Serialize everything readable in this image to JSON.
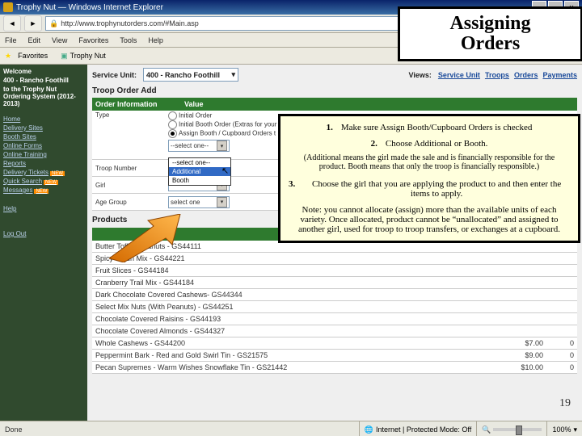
{
  "window": {
    "title": "Trophy Nut — Windows Internet Explorer"
  },
  "address": {
    "url": "http://www.trophynutorders.com/#Main.asp"
  },
  "menu": [
    "File",
    "Edit",
    "View",
    "Favorites",
    "Tools",
    "Help"
  ],
  "favorites": {
    "label": "Favorites",
    "item": "Trophy Nut"
  },
  "sidebar": {
    "welcome1": "Welcome",
    "welcome2": "400 - Rancho Foothill",
    "welcome3": "to the Trophy Nut Ordering System (2012-2013)",
    "links": [
      {
        "label": "Home"
      },
      {
        "label": "Delivery Sites"
      },
      {
        "label": "Booth Sites"
      },
      {
        "label": "Online Forms"
      },
      {
        "label": "Online Training"
      },
      {
        "label": "Reports"
      },
      {
        "label": "Delivery Tickets",
        "tag": "NEW"
      },
      {
        "label": "Quick Search",
        "tag": "NEW"
      },
      {
        "label": "Messages",
        "tag": "NEW"
      }
    ],
    "help": "Help",
    "logout": "Log Out"
  },
  "topctrls": {
    "su_label": "Service Unit:",
    "su_value": "400 - Rancho Foothill",
    "views_label": "Views:",
    "views": [
      "Service Unit",
      "Troops",
      "Orders",
      "Payments"
    ]
  },
  "section": {
    "title": "Troop Order Add"
  },
  "orderinfo": {
    "header_col1": "Order Information",
    "header_col2": "Value",
    "type_label": "Type",
    "radios": [
      "Initial Order",
      "Initial Booth Order (Extras for your",
      "Assign Booth / Cupboard Orders t"
    ],
    "sel_placeholder": "--select one--",
    "open_options": [
      "--select one--",
      "Additional",
      "Booth"
    ],
    "troop_label": "Troop Number",
    "girl_label": "Girl",
    "age_label": "Age Group",
    "age_value": "select one"
  },
  "products": {
    "title": "Products",
    "header": "Description",
    "rows": [
      {
        "desc": "Butter Toffee Peanuts - GS44111",
        "price": "",
        "qty": ""
      },
      {
        "desc": "Spicy Cajun Mix - GS44221",
        "price": "",
        "qty": ""
      },
      {
        "desc": "Fruit Slices - GS44184",
        "price": "",
        "qty": ""
      },
      {
        "desc": "Cranberry Trail Mix - GS44184",
        "price": "",
        "qty": ""
      },
      {
        "desc": "Dark Chocolate Covered Cashews- GS44344",
        "price": "",
        "qty": ""
      },
      {
        "desc": "Select Mix Nuts (With Peanuts) - GS44251",
        "price": "",
        "qty": ""
      },
      {
        "desc": "Chocolate Covered Raisins - GS44193",
        "price": "",
        "qty": ""
      },
      {
        "desc": "Chocolate Covered Almonds - GS44327",
        "price": "",
        "qty": ""
      },
      {
        "desc": "Whole Cashews - GS44200",
        "price": "$7.00",
        "qty": "0"
      },
      {
        "desc": "Peppermint Bark - Red and Gold Swirl Tin - GS21575",
        "price": "$9.00",
        "qty": "0"
      },
      {
        "desc": "Pecan Supremes - Warm Wishes Snowflake Tin - GS21442",
        "price": "$10.00",
        "qty": "0"
      }
    ]
  },
  "callout": {
    "title_l1": "Assigning",
    "title_l2": "Orders",
    "step1_num": "1.",
    "step1": "Make sure Assign Booth/Cupboard Orders is checked",
    "step2_num": "2.",
    "step2": "Choose Additional or Booth.",
    "paren": "(Additional means the girl made the sale and is financially responsible for the product. Booth means that only the troop is financially responsible.)",
    "step3_num": "3.",
    "step3": "Choose the girl that you are applying the product to and then enter the items to apply.",
    "note": "Note: you cannot allocate (assign) more than the available units of each variety. Once allocated, product cannot be “unallocated” and assigned to another girl, used for troop to troop transfers, or exchanges at a cupboard."
  },
  "slidenum": "19",
  "status": {
    "done": "Done",
    "internet": "Internet | Protected Mode: Off",
    "zoom": "100%"
  }
}
